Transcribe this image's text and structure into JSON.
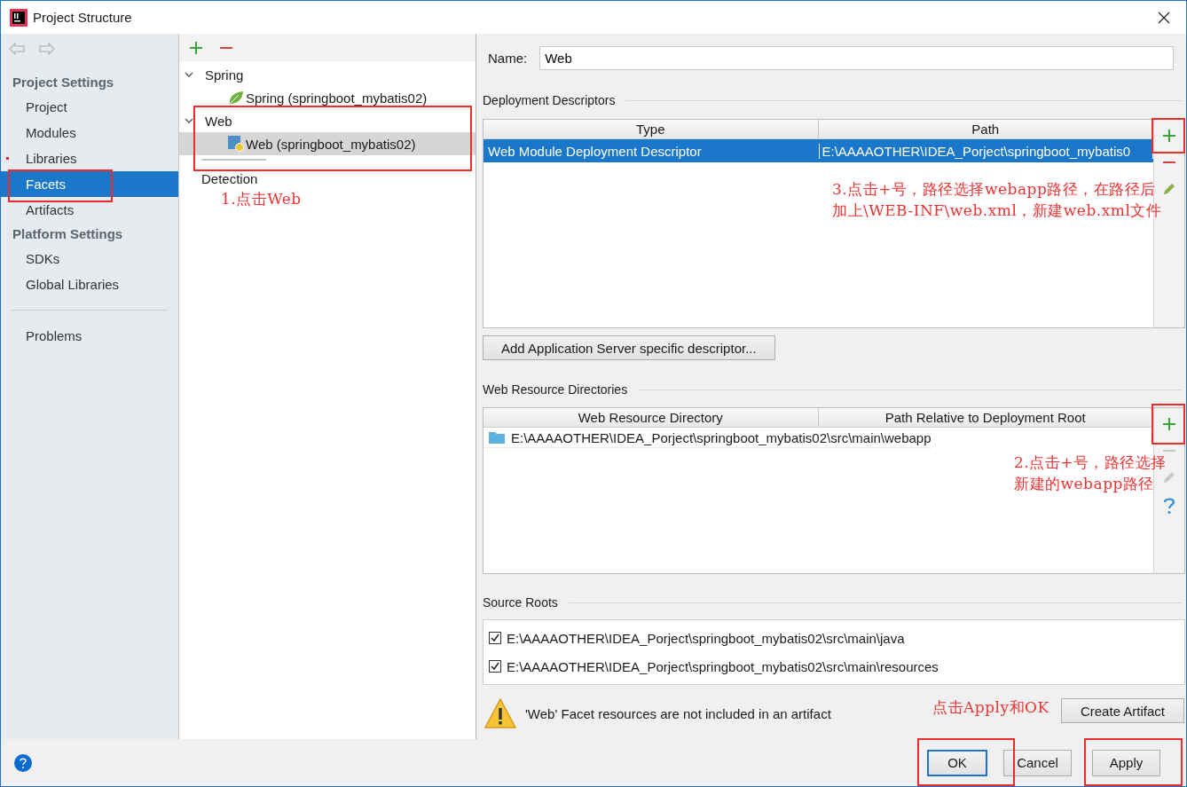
{
  "window": {
    "title": "Project Structure"
  },
  "sidebar": {
    "sections": [
      {
        "heading": "Project Settings",
        "items": [
          {
            "label": "Project",
            "selected": false,
            "error": false
          },
          {
            "label": "Modules",
            "selected": false,
            "error": false
          },
          {
            "label": "Libraries",
            "selected": false,
            "error": true
          },
          {
            "label": "Facets",
            "selected": true,
            "error": false
          },
          {
            "label": "Artifacts",
            "selected": false,
            "error": false
          }
        ]
      },
      {
        "heading": "Platform Settings",
        "items": [
          {
            "label": "SDKs",
            "selected": false,
            "error": false
          },
          {
            "label": "Global Libraries",
            "selected": false,
            "error": false
          }
        ]
      }
    ],
    "extra_items": [
      {
        "label": "Problems",
        "selected": false,
        "error": false
      }
    ]
  },
  "tree": {
    "groups": [
      {
        "label": "Spring",
        "expanded": true,
        "children": [
          {
            "label": "Spring (springboot_mybatis02)",
            "kind": "spring",
            "selected": false
          }
        ]
      },
      {
        "label": "Web",
        "expanded": true,
        "children": [
          {
            "label": "Web (springboot_mybatis02)",
            "kind": "web",
            "selected": true
          }
        ]
      }
    ],
    "detection": "Detection"
  },
  "detail": {
    "name_label": "Name:",
    "name_value": "Web",
    "deployment_descriptors": {
      "title": "Deployment Descriptors",
      "columns": [
        "Type",
        "Path"
      ],
      "rows": [
        {
          "cells": [
            "Web Module Deployment Descriptor",
            "E:\\AAAAOTHER\\IDEA_Porject\\springboot_mybatis0"
          ],
          "selected": true
        }
      ],
      "add_button": "Add Application Server specific descriptor..."
    },
    "web_resource_directories": {
      "title": "Web Resource Directories",
      "columns": [
        "Web Resource Directory",
        "Path Relative to Deployment Root"
      ],
      "rows": [
        {
          "directory": "E:\\AAAAOTHER\\IDEA_Porject\\springboot_mybatis02\\src\\main\\webapp",
          "selected": false
        }
      ]
    },
    "source_roots": {
      "title": "Source Roots",
      "items": [
        {
          "path": "E:\\AAAAOTHER\\IDEA_Porject\\springboot_mybatis02\\src\\main\\java",
          "checked": true
        },
        {
          "path": "E:\\AAAAOTHER\\IDEA_Porject\\springboot_mybatis02\\src\\main\\resources",
          "checked": true
        }
      ]
    },
    "warning": "'Web' Facet resources are not included in an artifact",
    "create_artifact": "Create Artifact"
  },
  "footer": {
    "buttons": [
      {
        "label": "OK",
        "default": true
      },
      {
        "label": "Cancel",
        "default": false
      },
      {
        "label": "Apply",
        "default": false
      }
    ]
  },
  "annotations": [
    {
      "lines": [
        "1.点击Web"
      ]
    },
    {
      "lines": [
        "3.点击+号，路径选择webapp路径，在路径后",
        "加上\\WEB-INF\\web.xml，新建web.xml文件"
      ]
    },
    {
      "lines": [
        "2.点击+号，路径选择",
        "新建的webapp路径"
      ]
    },
    {
      "lines": [
        "点击Apply和OK"
      ]
    }
  ]
}
